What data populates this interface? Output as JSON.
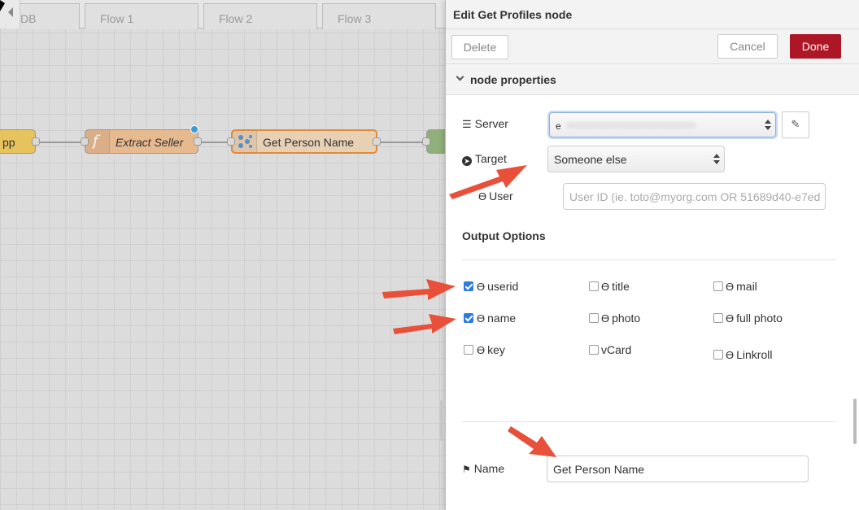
{
  "workspace": {
    "tabs": [
      {
        "label": "DB"
      },
      {
        "label": "Flow 1"
      },
      {
        "label": "Flow 2"
      },
      {
        "label": "Flow 3"
      }
    ],
    "nodes": {
      "app_label": "pp",
      "function_label": "Extract Seller",
      "profile_label": "Get Person Name"
    },
    "colors": {
      "app": "#e6c35c",
      "function": "#e6b98f",
      "profile": "#e8d0b4",
      "accent": "#e08a3c"
    }
  },
  "tray": {
    "title": "Edit Get Profiles node",
    "delete_label": "Delete",
    "cancel_label": "Cancel",
    "done_label": "Done",
    "section_label": "node properties",
    "server_label": "Server",
    "server_value": "e",
    "target_label": "Target",
    "target_value": "Someone else",
    "user_label": "User",
    "user_placeholder": "User ID (ie. toto@myorg.com OR 51689d40-e7ed",
    "output_options_label": "Output Options",
    "options": [
      {
        "label": "userid",
        "checked": true,
        "icon": "user-icon"
      },
      {
        "label": "title",
        "checked": false,
        "icon": "user-icon"
      },
      {
        "label": "mail",
        "checked": false,
        "icon": "user-icon"
      },
      {
        "label": "name",
        "checked": true,
        "icon": "user-icon"
      },
      {
        "label": "photo",
        "checked": false,
        "icon": "user-icon"
      },
      {
        "label": "full photo",
        "checked": false,
        "icon": "user-icon"
      },
      {
        "label": "key",
        "checked": false,
        "icon": "user-icon"
      },
      {
        "label": "vCard",
        "checked": false,
        "icon": ""
      },
      {
        "label": "Linkroll",
        "checked": false,
        "icon": "user-icon"
      }
    ],
    "name_label": "Name",
    "name_value": "Get Person Name",
    "colors": {
      "done": "#ad1625",
      "checkbox": "#2b7be0",
      "annotation_arrow": "#e8503a"
    }
  }
}
